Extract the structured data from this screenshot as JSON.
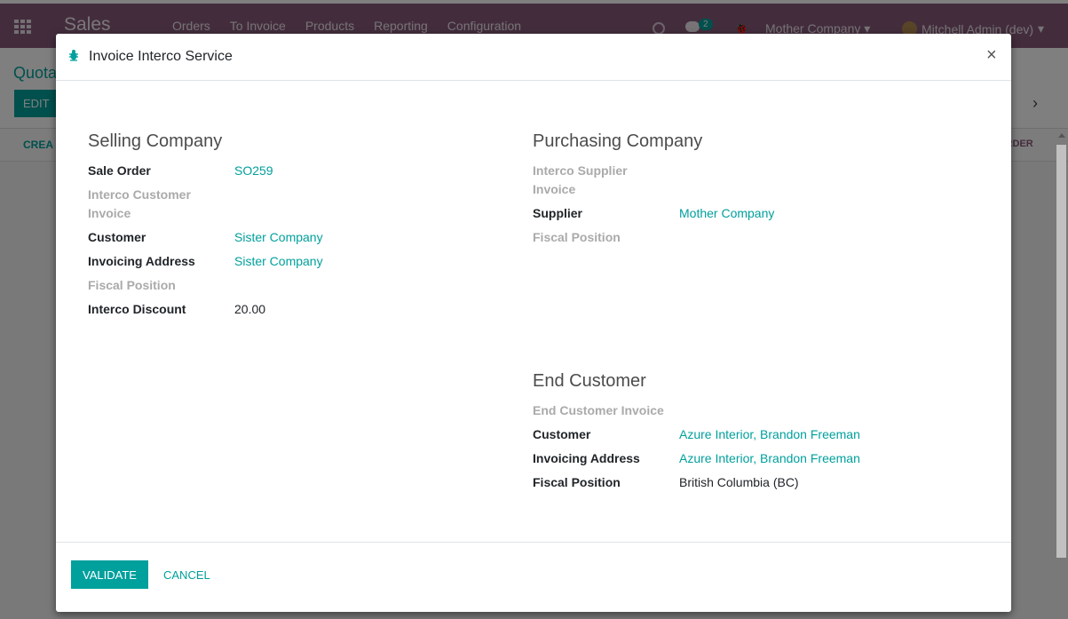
{
  "topbar": {
    "app_title": "Sales",
    "menu": [
      "Orders",
      "To Invoice",
      "Products",
      "Reporting",
      "Configuration"
    ],
    "chat_count": "2",
    "company": "Mother Company",
    "user": "Mitchell Admin (dev)"
  },
  "background": {
    "page_title": "Quota",
    "edit_label": "EDIT",
    "create_label": "CREA",
    "order_label": "ORDER"
  },
  "modal": {
    "title": "Invoice Interco Service",
    "close_label": "×",
    "validate_label": "VALIDATE",
    "cancel_label": "CANCEL",
    "selling": {
      "title": "Selling Company",
      "sale_order_label": "Sale Order",
      "sale_order_value": "SO259",
      "customer_invoice_label": "Interco Customer Invoice",
      "customer_label": "Customer",
      "customer_value": "Sister Company",
      "invoicing_address_label": "Invoicing Address",
      "invoicing_address_value": "Sister Company",
      "fiscal_position_label": "Fiscal Position",
      "discount_label": "Interco Discount",
      "discount_value": "20.00"
    },
    "purchasing": {
      "title": "Purchasing Company",
      "supplier_invoice_label": "Interco Supplier Invoice",
      "supplier_label": "Supplier",
      "supplier_value": "Mother Company",
      "fiscal_position_label": "Fiscal Position"
    },
    "end_customer": {
      "title": "End Customer",
      "invoice_label": "End Customer Invoice",
      "customer_label": "Customer",
      "customer_value": "Azure Interior, Brandon Freeman",
      "invoicing_address_label": "Invoicing Address",
      "invoicing_address_value": "Azure Interior, Brandon Freeman",
      "fiscal_position_label": "Fiscal Position",
      "fiscal_position_value": "British Columbia (BC)"
    }
  },
  "colors": {
    "brand": "#875a7b",
    "accent": "#00a09d"
  }
}
